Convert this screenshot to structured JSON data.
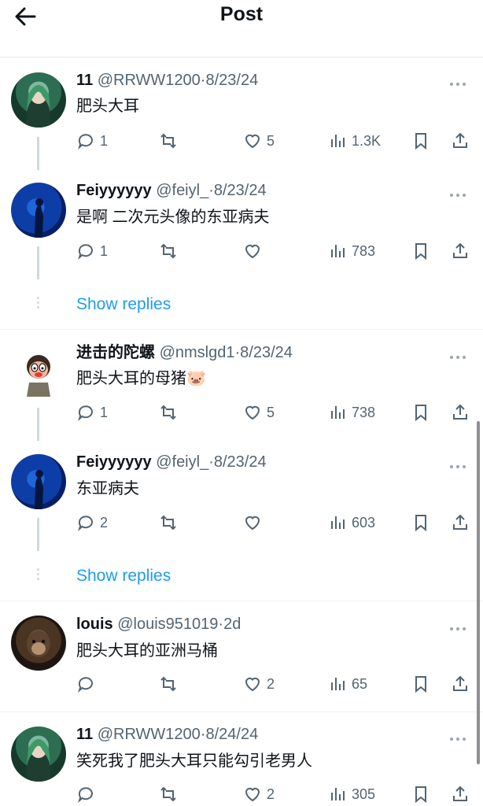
{
  "header": {
    "title": "Post"
  },
  "tweets": [
    {
      "name": "11",
      "handle": "@RRWW1200",
      "date": "8/23/24",
      "text": "肥头大耳",
      "reply_count": "1",
      "retweet_count": "",
      "like_count": "5",
      "view_count": "1.3K",
      "avatar": "green-hair-avatar"
    },
    {
      "name": "Feiyyyyyy",
      "handle": "@feiyl_",
      "date": "8/23/24",
      "text": "是啊 二次元头像的东亚病夫",
      "reply_count": "1",
      "retweet_count": "",
      "like_count": "",
      "view_count": "783",
      "avatar": "blue-silhouette-avatar"
    },
    {
      "name": "进击的陀螺",
      "handle": "@nmslgd1",
      "date": "8/23/24",
      "text": "肥头大耳的母猪🐷",
      "reply_count": "1",
      "retweet_count": "",
      "like_count": "5",
      "view_count": "738",
      "avatar": "cartoon-avatar"
    },
    {
      "name": "Feiyyyyyy",
      "handle": "@feiyl_",
      "date": "8/23/24",
      "text": "东亚病夫",
      "reply_count": "2",
      "retweet_count": "",
      "like_count": "",
      "view_count": "603",
      "avatar": "blue-silhouette-avatar"
    },
    {
      "name": "louis",
      "handle": "@louis951019",
      "date": "2d",
      "text": "肥头大耳的亚洲马桶",
      "reply_count": "",
      "retweet_count": "",
      "like_count": "2",
      "view_count": "65",
      "avatar": "monkey-avatar"
    },
    {
      "name": "11",
      "handle": "@RRWW1200",
      "date": "8/24/24",
      "text": "笑死我了肥头大耳只能勾引老男人",
      "reply_count": "",
      "retweet_count": "",
      "like_count": "2",
      "view_count": "305",
      "avatar": "green-hair-avatar"
    }
  ],
  "show_replies_label": "Show replies",
  "sep": "·",
  "colors": {
    "link": "#1d9bf0",
    "meta": "#536471",
    "text": "#0f1419"
  }
}
